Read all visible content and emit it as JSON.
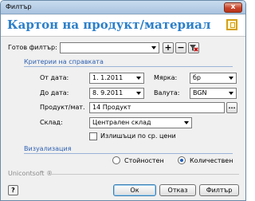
{
  "window": {
    "title": "Филтър",
    "close_label": "x"
  },
  "header": {
    "title": "Картон на продукт/материал"
  },
  "ready_filter": {
    "label": "Готов филтър:",
    "value": "",
    "add": "+",
    "remove": "−"
  },
  "criteria": {
    "section_label": "Критерии на справката",
    "from_date_label": "От дата:",
    "from_date": "1. 1.2011",
    "to_date_label": "До дата:",
    "to_date": "8. 9.2011",
    "measure_label": "Мярка:",
    "measure": "бр",
    "currency_label": "Валута:",
    "currency": "BGN",
    "product_label": "Продукт/мат.",
    "product": "14 Продукт",
    "browse": "...",
    "warehouse_label": "Склад:",
    "warehouse": "Централен склад",
    "surplus_label": "Излишъци по ср. цени"
  },
  "visualization": {
    "section_label": "Визуализация",
    "value_option": "Стойностен",
    "quantity_option": "Количествен",
    "selected": "quantity"
  },
  "footer": {
    "brand": "Unicontsoft ®",
    "help_label": "?",
    "ok_label": "Ок",
    "cancel_label": "Отказ",
    "filter_label": "Филтър"
  },
  "colors": {
    "accent": "#2c7fc9",
    "section": "#2c5fb0",
    "close": "#c7432a"
  }
}
